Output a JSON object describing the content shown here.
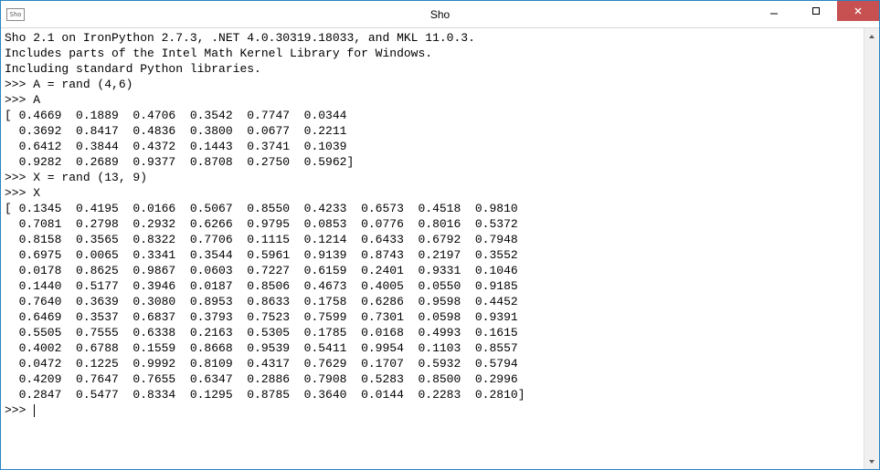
{
  "window": {
    "icon_label": "Sho",
    "title": "Sho"
  },
  "console": {
    "banner": [
      "Sho 2.1 on IronPython 2.7.3, .NET 4.0.30319.18033, and MKL 11.0.3.",
      "Includes parts of the Intel Math Kernel Library for Windows.",
      "Including standard Python libraries."
    ],
    "prompt": ">>> ",
    "entries": [
      {
        "input": "A = rand (4,6)",
        "output_lines": []
      },
      {
        "input": "A",
        "output_matrix": {
          "name": "A",
          "rows": 4,
          "cols": 6,
          "data": [
            [
              0.4669,
              0.1889,
              0.4706,
              0.3542,
              0.7747,
              0.0344
            ],
            [
              0.3692,
              0.8417,
              0.4836,
              0.38,
              0.0677,
              0.2211
            ],
            [
              0.6412,
              0.3844,
              0.4372,
              0.1443,
              0.3741,
              0.1039
            ],
            [
              0.9282,
              0.2689,
              0.9377,
              0.8708,
              0.275,
              0.5962
            ]
          ]
        }
      },
      {
        "input": "X = rand (13, 9)",
        "output_lines": []
      },
      {
        "input": "X",
        "output_matrix": {
          "name": "X",
          "rows": 13,
          "cols": 9,
          "data": [
            [
              0.1345,
              0.4195,
              0.0166,
              0.5067,
              0.855,
              0.4233,
              0.6573,
              0.4518,
              0.981
            ],
            [
              0.7081,
              0.2798,
              0.2932,
              0.6266,
              0.9795,
              0.0853,
              0.0776,
              0.8016,
              0.5372
            ],
            [
              0.8158,
              0.3565,
              0.8322,
              0.7706,
              0.1115,
              0.1214,
              0.6433,
              0.6792,
              0.7948
            ],
            [
              0.6975,
              0.0065,
              0.3341,
              0.3544,
              0.5961,
              0.9139,
              0.8743,
              0.2197,
              0.3552
            ],
            [
              0.0178,
              0.8625,
              0.9867,
              0.0603,
              0.7227,
              0.6159,
              0.2401,
              0.9331,
              0.1046
            ],
            [
              0.144,
              0.5177,
              0.3946,
              0.0187,
              0.8506,
              0.4673,
              0.4005,
              0.055,
              0.9185
            ],
            [
              0.764,
              0.3639,
              0.308,
              0.8953,
              0.8633,
              0.1758,
              0.6286,
              0.9598,
              0.4452
            ],
            [
              0.6469,
              0.3537,
              0.6837,
              0.3793,
              0.7523,
              0.7599,
              0.7301,
              0.0598,
              0.9391
            ],
            [
              0.5505,
              0.7555,
              0.6338,
              0.2163,
              0.5305,
              0.1785,
              0.0168,
              0.4993,
              0.1615
            ],
            [
              0.4002,
              0.6788,
              0.1559,
              0.8668,
              0.9539,
              0.5411,
              0.9954,
              0.1103,
              0.8557
            ],
            [
              0.0472,
              0.1225,
              0.9992,
              0.8109,
              0.4317,
              0.7629,
              0.1707,
              0.5932,
              0.5794
            ],
            [
              0.4209,
              0.7647,
              0.7655,
              0.6347,
              0.2886,
              0.7908,
              0.5283,
              0.85,
              0.2996
            ],
            [
              0.2847,
              0.5477,
              0.8334,
              0.1295,
              0.8785,
              0.364,
              0.0144,
              0.2283,
              0.281
            ]
          ]
        }
      }
    ]
  }
}
